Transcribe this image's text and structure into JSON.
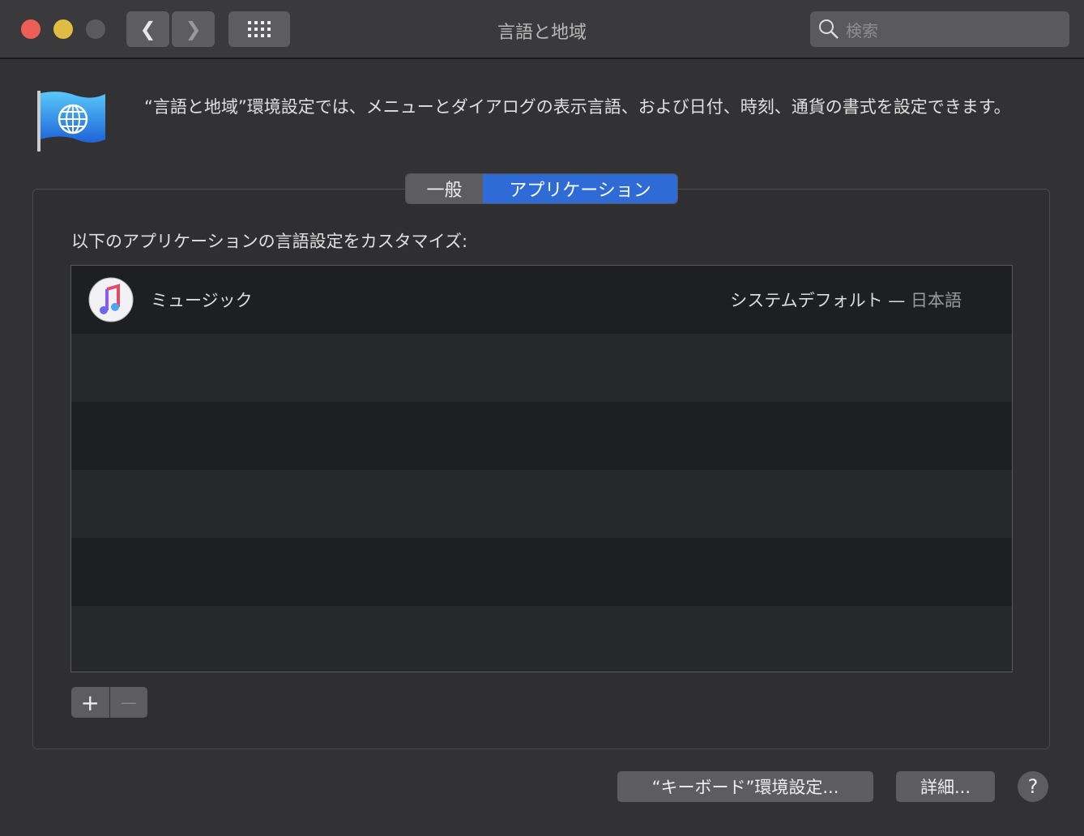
{
  "window": {
    "title": "言語と地域",
    "search_placeholder": "検索"
  },
  "description": "“言語と地域”環境設定では、メニューとダイアログの表示言語、および日付、時刻、通貨の書式を設定できます。",
  "tabs": [
    {
      "label": "一般",
      "selected": false
    },
    {
      "label": "アプリケーション",
      "selected": true
    }
  ],
  "section_label": "以下のアプリケーションの言語設定をカスタマイズ:",
  "apps": [
    {
      "name": "ミュージック",
      "language_prefix": "システムデフォルト —",
      "language": "日本語"
    }
  ],
  "buttons": {
    "add": "+",
    "remove": "—",
    "keyboard": "“キーボード”環境設定...",
    "advanced": "詳細...",
    "help": "?"
  },
  "colors": {
    "accent": "#2e6bd6",
    "close": "#ec5f57",
    "minimize": "#e0bc44"
  }
}
